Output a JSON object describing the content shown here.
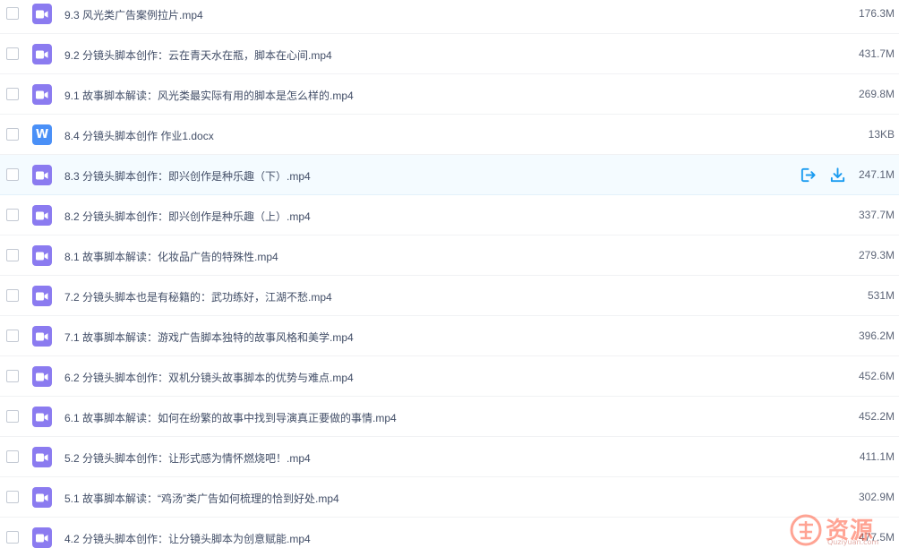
{
  "files": [
    {
      "name": "9.3 风光类广告案例拉片.mp4",
      "size": "176.3M",
      "type": "video"
    },
    {
      "name": "9.2 分镜头脚本创作：云在青天水在瓶，脚本在心间.mp4",
      "size": "431.7M",
      "type": "video"
    },
    {
      "name": "9.1 故事脚本解读：风光类最实际有用的脚本是怎么样的.mp4",
      "size": "269.8M",
      "type": "video"
    },
    {
      "name": "8.4 分镜头脚本创作 作业1.docx",
      "size": "13KB",
      "type": "doc",
      "badge": "W"
    },
    {
      "name": "8.3 分镜头脚本创作：即兴创作是种乐趣（下）.mp4",
      "size": "247.1M",
      "type": "video",
      "hover": true
    },
    {
      "name": "8.2 分镜头脚本创作：即兴创作是种乐趣（上）.mp4",
      "size": "337.7M",
      "type": "video"
    },
    {
      "name": "8.1 故事脚本解读：化妆品广告的特殊性.mp4",
      "size": "279.3M",
      "type": "video"
    },
    {
      "name": "7.2 分镜头脚本也是有秘籍的：武功练好，江湖不愁.mp4",
      "size": "531M",
      "type": "video"
    },
    {
      "name": "7.1 故事脚本解读：游戏广告脚本独特的故事风格和美学.mp4",
      "size": "396.2M",
      "type": "video"
    },
    {
      "name": "6.2 分镜头脚本创作：双机分镜头故事脚本的优势与难点.mp4",
      "size": "452.6M",
      "type": "video"
    },
    {
      "name": "6.1 故事脚本解读：如何在纷繁的故事中找到导演真正要做的事情.mp4",
      "size": "452.2M",
      "type": "video"
    },
    {
      "name": "5.2 分镜头脚本创作：让形式感为情怀燃烧吧！.mp4",
      "size": "411.1M",
      "type": "video"
    },
    {
      "name": "5.1 故事脚本解读：“鸡汤”类广告如何梳理的恰到好处.mp4",
      "size": "302.9M",
      "type": "video"
    },
    {
      "name": "4.2 分镜头脚本创作：让分镜头脚本为创意赋能.mp4",
      "size": "477.5M",
      "type": "video"
    }
  ],
  "watermark": {
    "text": "资源",
    "sub": "Quziyuan.com",
    "color": "#ff5a3c"
  },
  "colors": {
    "video_icon": "#8b7bf0",
    "doc_icon": "#4a90f7",
    "action_icon": "#1a9bf0",
    "hover_bg": "#f4fbff"
  },
  "icons": {
    "video": "video-camera-icon",
    "doc": "word-doc-icon",
    "actions": [
      "share-icon",
      "download-icon"
    ]
  }
}
